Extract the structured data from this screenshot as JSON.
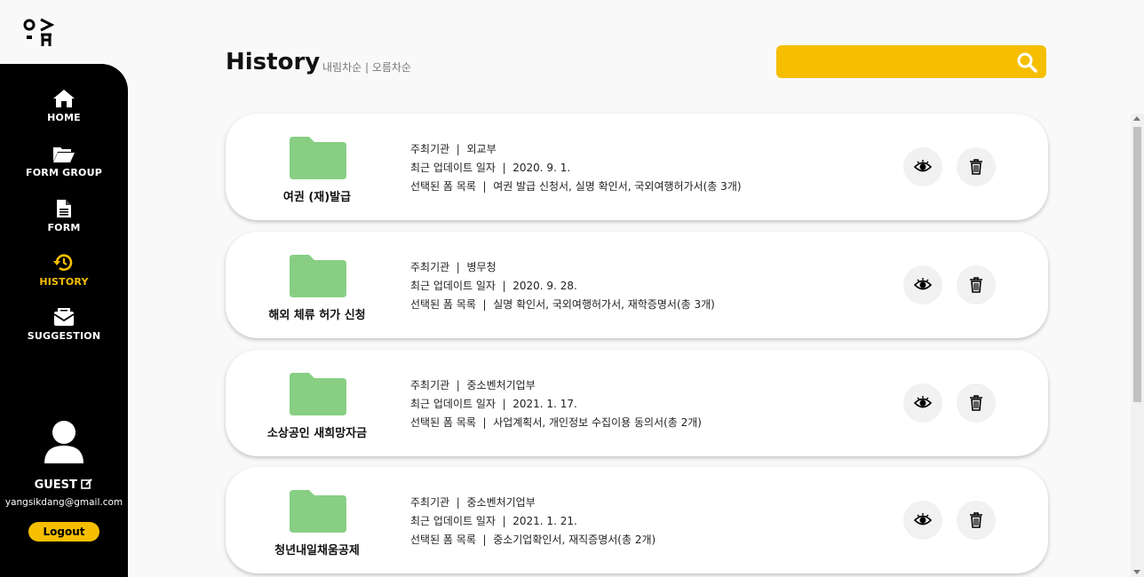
{
  "nav": [
    {
      "label": "HOME",
      "icon": "home-icon",
      "active": false
    },
    {
      "label": "FORM GROUP",
      "icon": "folder-open-icon",
      "active": false
    },
    {
      "label": "FORM",
      "icon": "document-icon",
      "active": false
    },
    {
      "label": "HISTORY",
      "icon": "history-icon",
      "active": true
    },
    {
      "label": "SUGGESTION",
      "icon": "mailbox-icon",
      "active": false
    }
  ],
  "user": {
    "name": "GUEST",
    "email": "yangsikdang@gmail.com",
    "logout": "Logout"
  },
  "header": {
    "title": "History",
    "sort_desc": "내림차순",
    "sort_sep": " | ",
    "sort_asc": "오름차순"
  },
  "search": {
    "placeholder": ""
  },
  "colors": {
    "accent": "#f5bf00",
    "folder": "#88cf84",
    "sidebar": "#000000"
  },
  "labels": {
    "org": "주최기관",
    "updated": "최근 업데이트 일자",
    "forms": "선택된 폼 목록",
    "sep": "  |  "
  },
  "cards": [
    {
      "name": "여권 (재)발급",
      "org": "외교부",
      "updated": "2020. 9. 1.",
      "forms": "여권 발급 신청서, 실명 확인서, 국외여행허가서(총 3개)"
    },
    {
      "name": "해외 체류 허가 신청",
      "org": "병무청",
      "updated": "2020. 9. 28.",
      "forms": "실명 확인서, 국외여행허가서, 재학증명서(총 3개)"
    },
    {
      "name": "소상공인 새희망자금",
      "org": "중소벤처기업부",
      "updated": "2021. 1. 17.",
      "forms": "사업계획서, 개인정보 수집이용 동의서(총 2개)"
    },
    {
      "name": "청년내일채움공제",
      "org": "중소벤처기업부",
      "updated": "2021. 1. 21.",
      "forms": "중소기업확인서, 재직증명서(총 2개)"
    }
  ]
}
